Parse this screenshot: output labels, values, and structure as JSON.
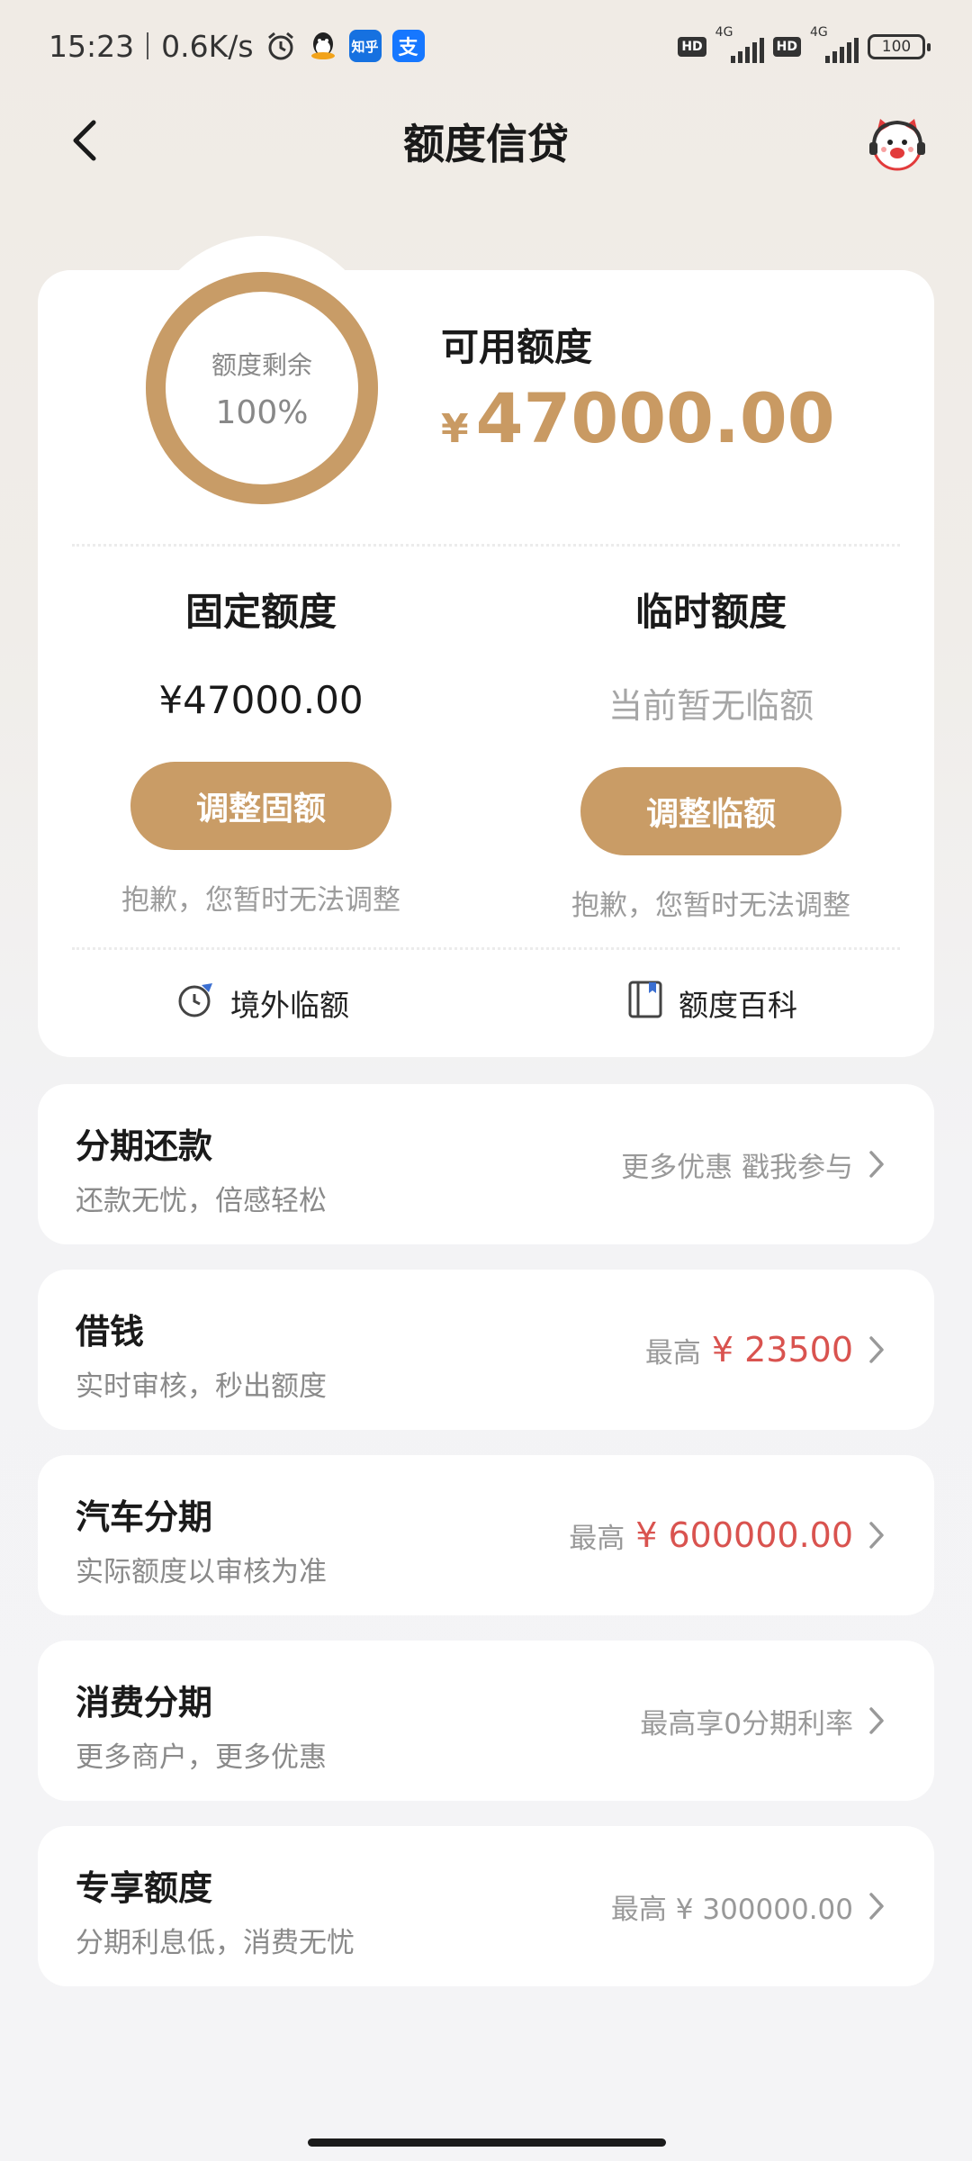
{
  "status_bar": {
    "time": "15:23",
    "speed": "0.6K/s",
    "icons": [
      "alarm-icon",
      "qq-icon",
      "zhihu-icon",
      "alipay-icon"
    ],
    "zhihu_label": "知乎",
    "alipay_label": "支",
    "hd1": "HD",
    "net1": "4G",
    "hd2": "HD",
    "net2": "4G",
    "battery": "100"
  },
  "header": {
    "title": "额度信贷",
    "back_icon": "back-arrow-icon",
    "service_icon": "customer-service-mascot-icon"
  },
  "quota_card": {
    "ring_label": "额度剩余",
    "ring_percent": "100%",
    "remaining_fraction": 1.0,
    "available_label": "可用额度",
    "currency": "¥",
    "available_amount": "47000.00",
    "fixed": {
      "title": "固定额度",
      "value": "¥47000.00",
      "button": "调整固额",
      "note": "抱歉，您暂时无法调整"
    },
    "temporary": {
      "title": "临时额度",
      "value": "当前暂无临额",
      "button": "调整临额",
      "note": "抱歉，您暂时无法调整"
    },
    "links": {
      "overseas": "境外临额",
      "encyclopedia": "额度百科"
    }
  },
  "items": [
    {
      "title": "分期还款",
      "subtitle": "还款无忧，倍感轻松",
      "right_text": "更多优惠  戳我参与"
    },
    {
      "title": "借钱",
      "subtitle": "实时审核，秒出额度",
      "right_prefix": "最高",
      "right_amount": "¥ 23500"
    },
    {
      "title": "汽车分期",
      "subtitle": "实际额度以审核为准",
      "right_prefix": "最高",
      "right_amount": "¥ 600000.00"
    },
    {
      "title": "消费分期",
      "subtitle": "更多商户，更多优惠",
      "right_text": "最高享0分期利率"
    },
    {
      "title": "专享额度",
      "subtitle": "分期利息低，消费无忧",
      "right_text": "最高 ¥ 300000.00"
    }
  ],
  "colors": {
    "accent_gold": "#c99c66",
    "amount_red": "#d9534f",
    "ring_gold": "#c89c67"
  }
}
